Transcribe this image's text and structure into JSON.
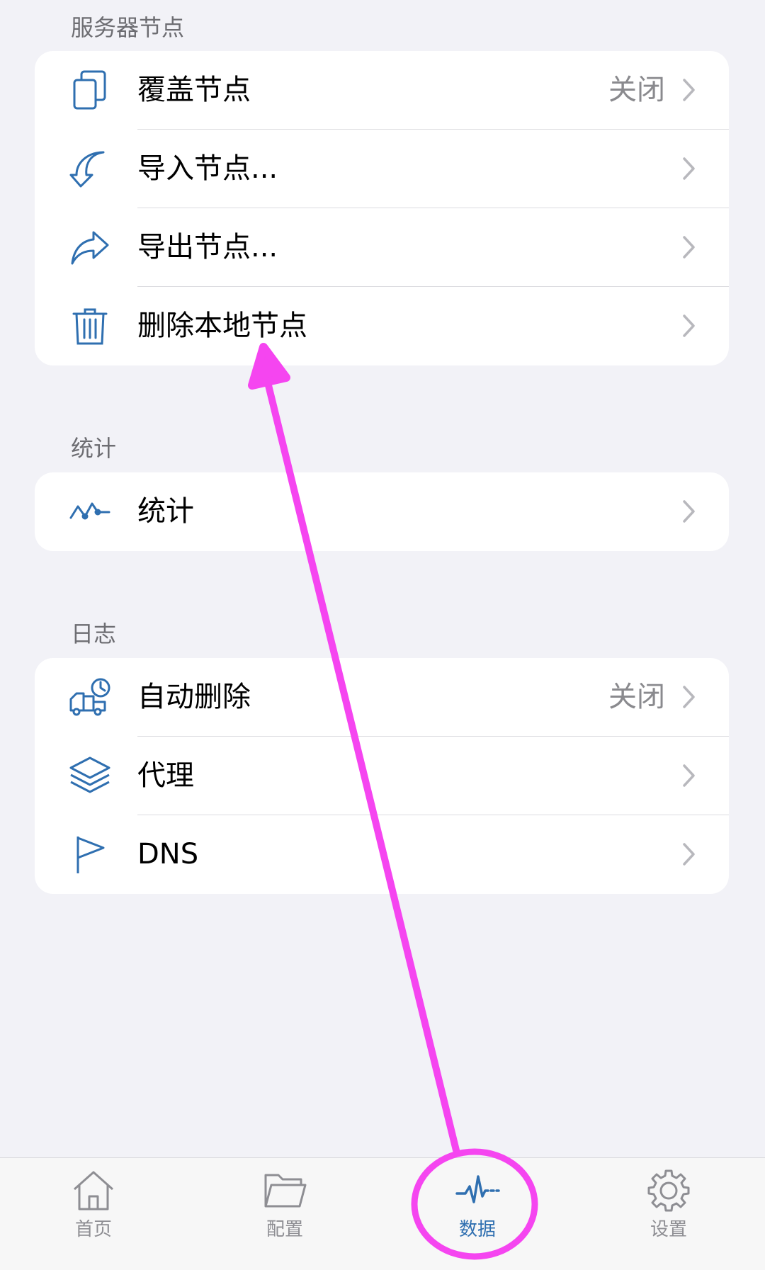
{
  "colors": {
    "background": "#f2f2f7",
    "card": "#ffffff",
    "icon_blue": "#2f6fb0",
    "secondary_text": "#8a8a8e",
    "annotation": "#f545f0"
  },
  "sections": [
    {
      "header": "服务器节点",
      "rows": [
        {
          "icon": "copy-icon",
          "label": "覆盖节点",
          "value": "关闭"
        },
        {
          "icon": "import-arrow-icon",
          "label": "导入节点...",
          "value": ""
        },
        {
          "icon": "share-arrow-icon",
          "label": "导出节点...",
          "value": ""
        },
        {
          "icon": "trash-icon",
          "label": "删除本地节点",
          "value": ""
        }
      ]
    },
    {
      "header": "统计",
      "rows": [
        {
          "icon": "activity-line-icon",
          "label": "统计",
          "value": ""
        }
      ]
    },
    {
      "header": "日志",
      "rows": [
        {
          "icon": "truck-clock-icon",
          "label": "自动删除",
          "value": "关闭"
        },
        {
          "icon": "layers-icon",
          "label": "代理",
          "value": ""
        },
        {
          "icon": "flag-icon",
          "label": "DNS",
          "value": ""
        }
      ]
    }
  ],
  "tabbar": {
    "items": [
      {
        "icon": "home-icon",
        "label": "首页",
        "active": false
      },
      {
        "icon": "folder-icon",
        "label": "配置",
        "active": false
      },
      {
        "icon": "pulse-icon",
        "label": "数据",
        "active": true
      },
      {
        "icon": "gear-icon",
        "label": "设置",
        "active": false
      }
    ]
  }
}
